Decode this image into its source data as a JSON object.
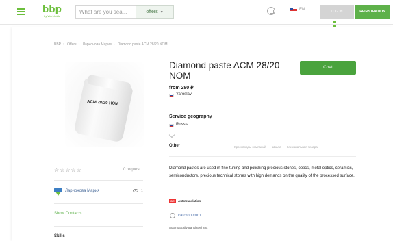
{
  "header": {
    "logo": "bbp",
    "logo_sub": "by Worldwide",
    "search_placeholder": "What are you sea...",
    "category_select": "offers",
    "language": "EN",
    "login_label": "LOG IN",
    "register_label": "REGISTRATION"
  },
  "breadcrumb": [
    "BBP",
    "Offers",
    "Ларионова Мария",
    "Diamond paste ACM 28/20 NOM"
  ],
  "product": {
    "image_label": "ACM 28/20 НОМ",
    "title": "Diamond paste ACM 28/20 NOM",
    "price": "from 280 ₽",
    "city": "Yaroslavl",
    "service_geography_title": "Service geography",
    "service_geography_value": "Russia",
    "other_title": "Other",
    "tags": [
      "Кроссворды компаний",
      "Шкала",
      "Кликанальная театра"
    ],
    "description": "Diamond pastes are used in fine-tuning and polishing precious stones, optics, metal optics, ceramics, semiconductors, precious technical stones with high demands on the quality of the processed surface.",
    "autotranslation_badge": "DE",
    "autotranslation_label": "Autotranslation",
    "site_link": "carcrop.com",
    "auto_note": "Automatically translated text",
    "chat_label": "Chat"
  },
  "seller": {
    "stars": "☆☆☆☆☆",
    "requests": "0 request",
    "name": "Ларионова Мария",
    "views": "1",
    "show_contacts": "Show Contacts",
    "skills_title": "Skills"
  },
  "colors": {
    "brand_green": "#6cbf3c",
    "chat_green": "#4aa33d",
    "register_green": "#5eb14a"
  }
}
